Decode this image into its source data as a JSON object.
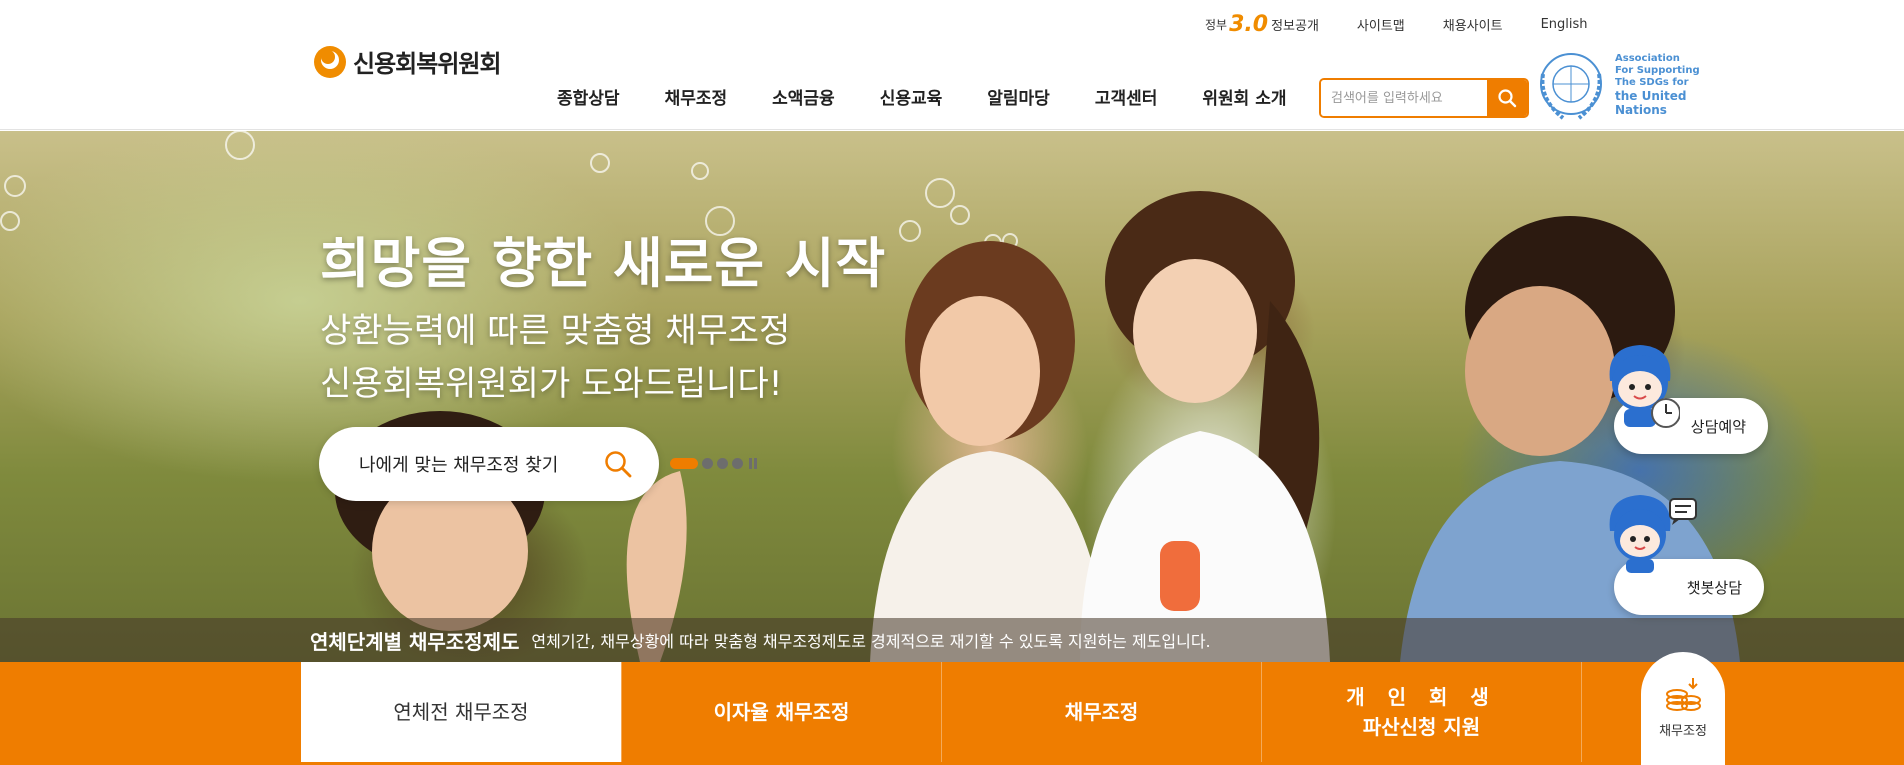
{
  "header": {
    "logo_text": "신용회복위원회",
    "util": {
      "gov_small": "정부",
      "gov_num": "3.0",
      "gov_label": "정보공개",
      "sitemap": "사이트맵",
      "recruit": "채용사이트",
      "english": "English"
    },
    "gnb": [
      "종합상담",
      "채무조정",
      "소액금융",
      "신용교육",
      "알림마당",
      "고객센터",
      "위원회 소개"
    ],
    "search": {
      "placeholder": "검색어를 입력하세요"
    },
    "un": {
      "line1": "Association",
      "line2": "For Supporting",
      "line3": "The SDGs for",
      "line4": "the United",
      "line5": "Nations"
    }
  },
  "hero": {
    "title": "희망을 향한 새로운 시작",
    "sub1": "상환능력에 따른 맞춤형 채무조정",
    "sub2": "신용회복위원회가 도와드립니다!",
    "find_button": "나에게 맞는 채무조정 찾기",
    "slides": {
      "count": 4,
      "active": 1
    },
    "side_buttons": {
      "reserve": "상담예약",
      "chatbot": "챗봇상담"
    },
    "notice_title": "연체단계별 채무조정제도",
    "notice_text": "연체기간, 채무상황에 따라 맞춤형 채무조정제도로 경제적으로 재기할 수 있도록 지원하는 제도입니다."
  },
  "tabs": {
    "items": [
      {
        "label": "연체전 채무조정",
        "active": true
      },
      {
        "label": "이자율 채무조정",
        "active": false
      },
      {
        "label": "채무조정",
        "active": false
      },
      {
        "label_line1": "개 인 회 생",
        "label_line2": "파산신청 지원",
        "active": false
      }
    ],
    "circle_label": "채무조정"
  },
  "colors": {
    "accent": "#ef7d00",
    "un_blue": "#4b90d3"
  }
}
